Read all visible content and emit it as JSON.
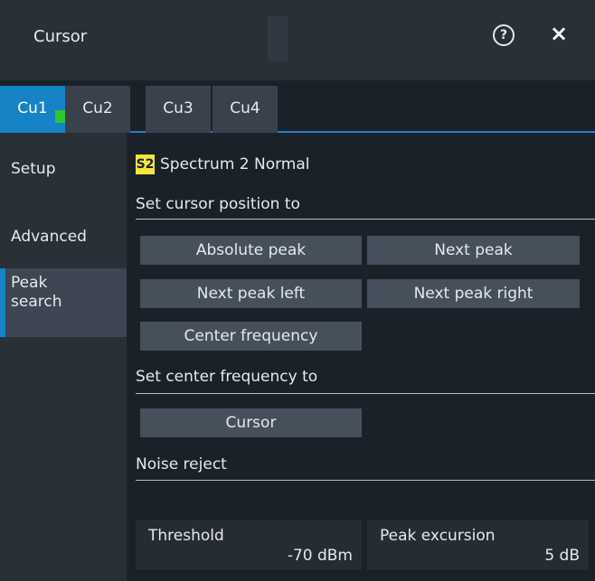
{
  "window": {
    "title": "Cursor",
    "help_icon": "?",
    "close_icon": "×"
  },
  "tabs": [
    {
      "label": "Cu1",
      "active": true,
      "indicator_color": "#2ec82e"
    },
    {
      "label": "Cu2",
      "active": false
    },
    {
      "label": "Cu3",
      "active": false
    },
    {
      "label": "Cu4",
      "active": false
    }
  ],
  "sidebar": {
    "items": [
      {
        "label": "Setup"
      },
      {
        "label": "Advanced"
      },
      {
        "label": "Peak\nsearch",
        "active": true
      }
    ]
  },
  "main": {
    "source": {
      "badge": "S2",
      "name": "Spectrum 2 Normal",
      "badge_color": "#f7e53a"
    },
    "cursor_position_section": "Set cursor position to",
    "buttons": {
      "absolute_peak": "Absolute peak",
      "next_peak": "Next peak",
      "next_peak_left": "Next peak left",
      "next_peak_right": "Next peak right",
      "center_frequency": "Center frequency"
    },
    "center_frequency_section": "Set center frequency to",
    "cursor_button": "Cursor",
    "noise_reject_section": "Noise reject",
    "threshold": {
      "label": "Threshold",
      "value": "-70 dBm"
    },
    "peak_excursion": {
      "label": "Peak excursion",
      "value": "5 dB"
    }
  },
  "colors": {
    "accent": "#1683c6",
    "panel_bg": "#1b2129",
    "button_bg": "#45505b"
  }
}
